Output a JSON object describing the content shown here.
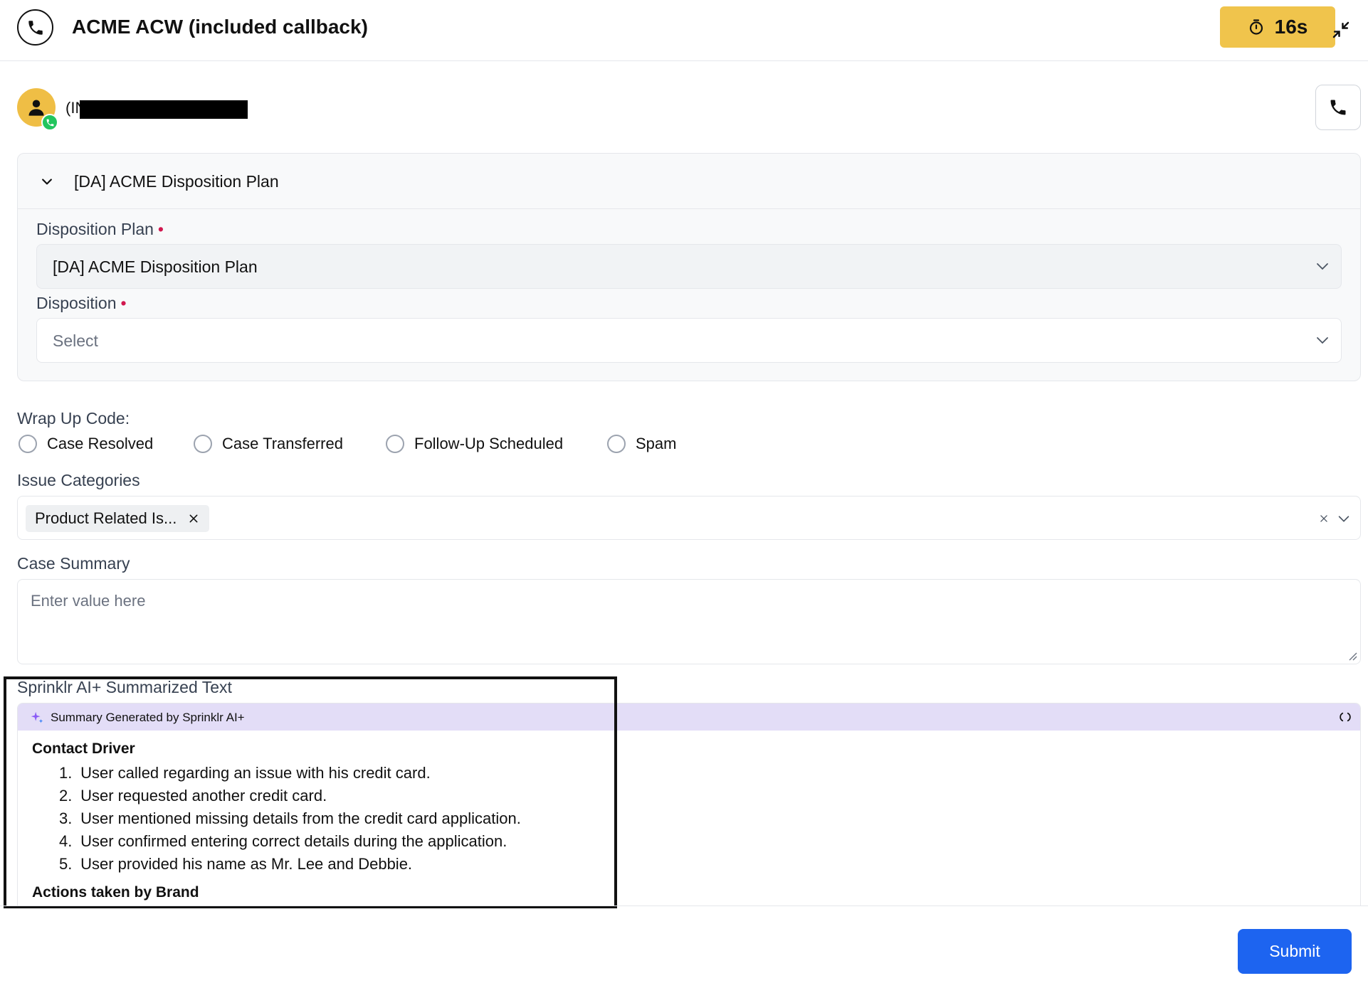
{
  "header": {
    "title": "ACME ACW (included callback)",
    "timer": "16s",
    "icons": {
      "call": "phone-icon",
      "timer": "stopwatch-icon",
      "collapse": "collapse-arrows-icon"
    }
  },
  "contact": {
    "name_prefix": "(IN",
    "redacted": true,
    "icons": {
      "avatar": "user-icon",
      "badge": "phone-badge-icon",
      "call": "phone-icon"
    }
  },
  "disposition_card": {
    "title": "[DA] ACME Disposition Plan",
    "plan_label": "Disposition Plan",
    "plan_value": "[DA] ACME Disposition Plan",
    "disposition_label": "Disposition",
    "disposition_placeholder": "Select",
    "required_mark": "•"
  },
  "wrap_up": {
    "label": "Wrap Up Code:",
    "options": [
      "Case Resolved",
      "Case Transferred",
      "Follow-Up Scheduled",
      "Spam"
    ]
  },
  "issue_categories": {
    "label": "Issue Categories",
    "chip": "Product Related Is..."
  },
  "case_summary": {
    "label": "Case Summary",
    "placeholder": "Enter value here"
  },
  "ai_summary": {
    "label": "Sprinklr AI+ Summarized Text",
    "banner": "Summary Generated by Sprinklr AI+",
    "section1_title": "Contact Driver",
    "items": [
      {
        "n": "1.",
        "text": "User called regarding an issue with his credit card."
      },
      {
        "n": "2.",
        "text": "User requested another credit card."
      },
      {
        "n": "3.",
        "text": "User mentioned missing details from the credit card application."
      },
      {
        "n": "4.",
        "text": "User confirmed entering correct details during the application."
      },
      {
        "n": "5.",
        "text": "User provided his name as Mr. Lee and Debbie."
      }
    ],
    "section2_title": "Actions taken by Brand"
  },
  "footer": {
    "submit_label": "Submit"
  },
  "colors": {
    "timer_bg": "#f0c44c",
    "submit_bg": "#1d64f0",
    "ai_banner_bg": "#e3ddf7",
    "required": "#d1174e"
  }
}
